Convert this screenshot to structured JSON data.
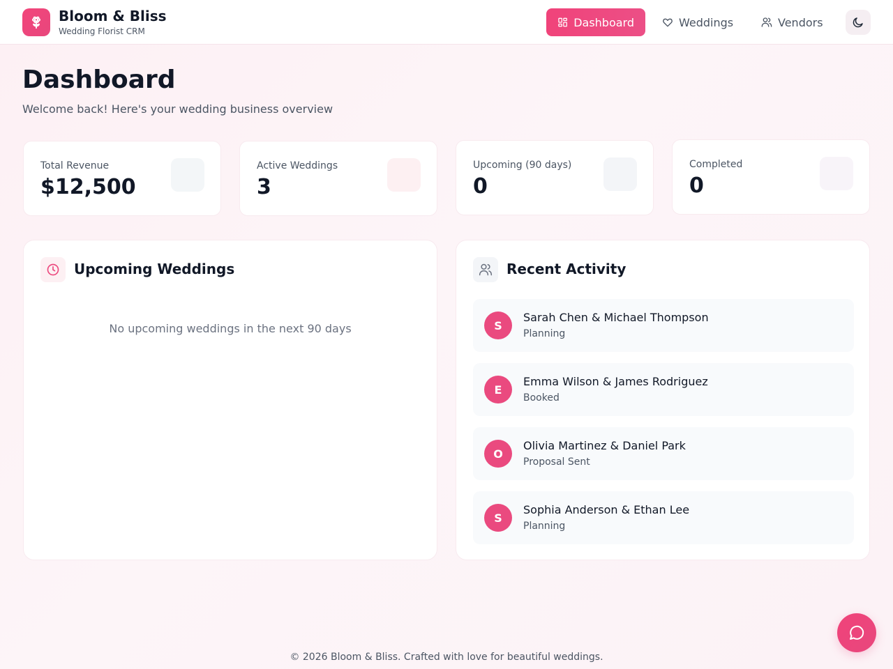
{
  "brand": {
    "name": "Bloom & Bliss",
    "subtitle": "Wedding Florist CRM",
    "logo_icon": "flower-icon"
  },
  "nav": {
    "items": [
      {
        "label": "Dashboard",
        "icon": "grid-icon",
        "active": true
      },
      {
        "label": "Weddings",
        "icon": "heart-icon",
        "active": false
      },
      {
        "label": "Vendors",
        "icon": "users-icon",
        "active": false
      }
    ],
    "theme_toggle_icon": "moon-icon"
  },
  "page": {
    "title": "Dashboard",
    "subtitle": "Welcome back! Here's your wedding business overview"
  },
  "stats": [
    {
      "label": "Total Revenue",
      "value": "$12,500",
      "icon_color": "#f3f6f8"
    },
    {
      "label": "Active Weddings",
      "value": "3",
      "icon_color": "#fdf0f2"
    },
    {
      "label": "Upcoming (90 days)",
      "value": "0",
      "icon_color": "#f3f5f8"
    },
    {
      "label": "Completed",
      "value": "0",
      "icon_color": "#f8f4f9"
    }
  ],
  "upcoming": {
    "title": "Upcoming Weddings",
    "icon": "clock-icon",
    "empty_text": "No upcoming weddings in the next 90 days"
  },
  "activity": {
    "title": "Recent Activity",
    "icon": "users-icon",
    "items": [
      {
        "initial": "S",
        "name": "Sarah Chen & Michael Thompson",
        "status": "Planning"
      },
      {
        "initial": "E",
        "name": "Emma Wilson & James Rodriguez",
        "status": "Booked"
      },
      {
        "initial": "O",
        "name": "Olivia Martinez & Daniel Park",
        "status": "Proposal Sent"
      },
      {
        "initial": "S",
        "name": "Sophia Anderson & Ethan Lee",
        "status": "Planning"
      }
    ]
  },
  "footer": {
    "text": "© 2026 Bloom & Bliss. Crafted with love for beautiful weddings."
  },
  "chat": {
    "icon": "chat-bubble-icon"
  },
  "colors": {
    "accent": "#ec4a7f",
    "text_primary": "#111827",
    "text_secondary": "#4b5563"
  }
}
